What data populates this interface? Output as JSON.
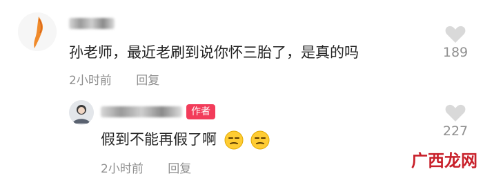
{
  "comments": [
    {
      "text": "孙老师，最近老刷到说你怀三胎了，是真的吗",
      "time": "2小时前",
      "reply_label": "回复",
      "likes": "189"
    }
  ],
  "reply": {
    "badge": "作者",
    "text": "假到不能再假了啊",
    "emojis": [
      "unamused-face-icon",
      "unamused-face-icon"
    ],
    "time": "2小时前",
    "reply_label": "回复",
    "likes": "227"
  },
  "watermark": "广西龙网",
  "colors": {
    "badge": "#f23c5a",
    "muted": "#8f8f8f",
    "watermark": "#c8202a"
  }
}
